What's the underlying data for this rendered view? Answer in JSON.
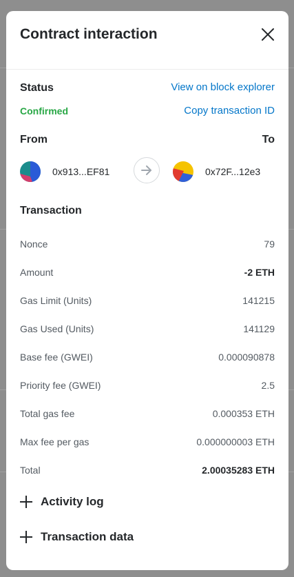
{
  "modal": {
    "title": "Contract interaction",
    "close_icon": "close-icon"
  },
  "status": {
    "label": "Status",
    "value": "Confirmed",
    "value_color": "#28a745",
    "view_explorer": "View on block explorer",
    "copy_tx_id": "Copy transaction ID",
    "link_color": "#0376c9"
  },
  "parties": {
    "from_label": "From",
    "to_label": "To",
    "from_address": "0x913...EF81",
    "to_address": "0x72F...12e3",
    "arrow_icon": "arrow-right-icon"
  },
  "transaction": {
    "label": "Transaction",
    "rows": [
      {
        "key": "Nonce",
        "value": "79"
      },
      {
        "key": "Amount",
        "value": "-2 ETH"
      },
      {
        "key": "Gas Limit (Units)",
        "value": "141215"
      },
      {
        "key": "Gas Used (Units)",
        "value": "141129"
      },
      {
        "key": "Base fee (GWEI)",
        "value": "0.000090878"
      },
      {
        "key": "Priority fee (GWEI)",
        "value": "2.5"
      },
      {
        "key": "Total gas fee",
        "value": "0.000353 ETH"
      },
      {
        "key": "Max fee per gas",
        "value": "0.000000003 ETH"
      },
      {
        "key": "Total",
        "value": "2.00035283 ETH"
      }
    ]
  },
  "sections": {
    "activity_log": "Activity log",
    "transaction_data": "Transaction data"
  }
}
